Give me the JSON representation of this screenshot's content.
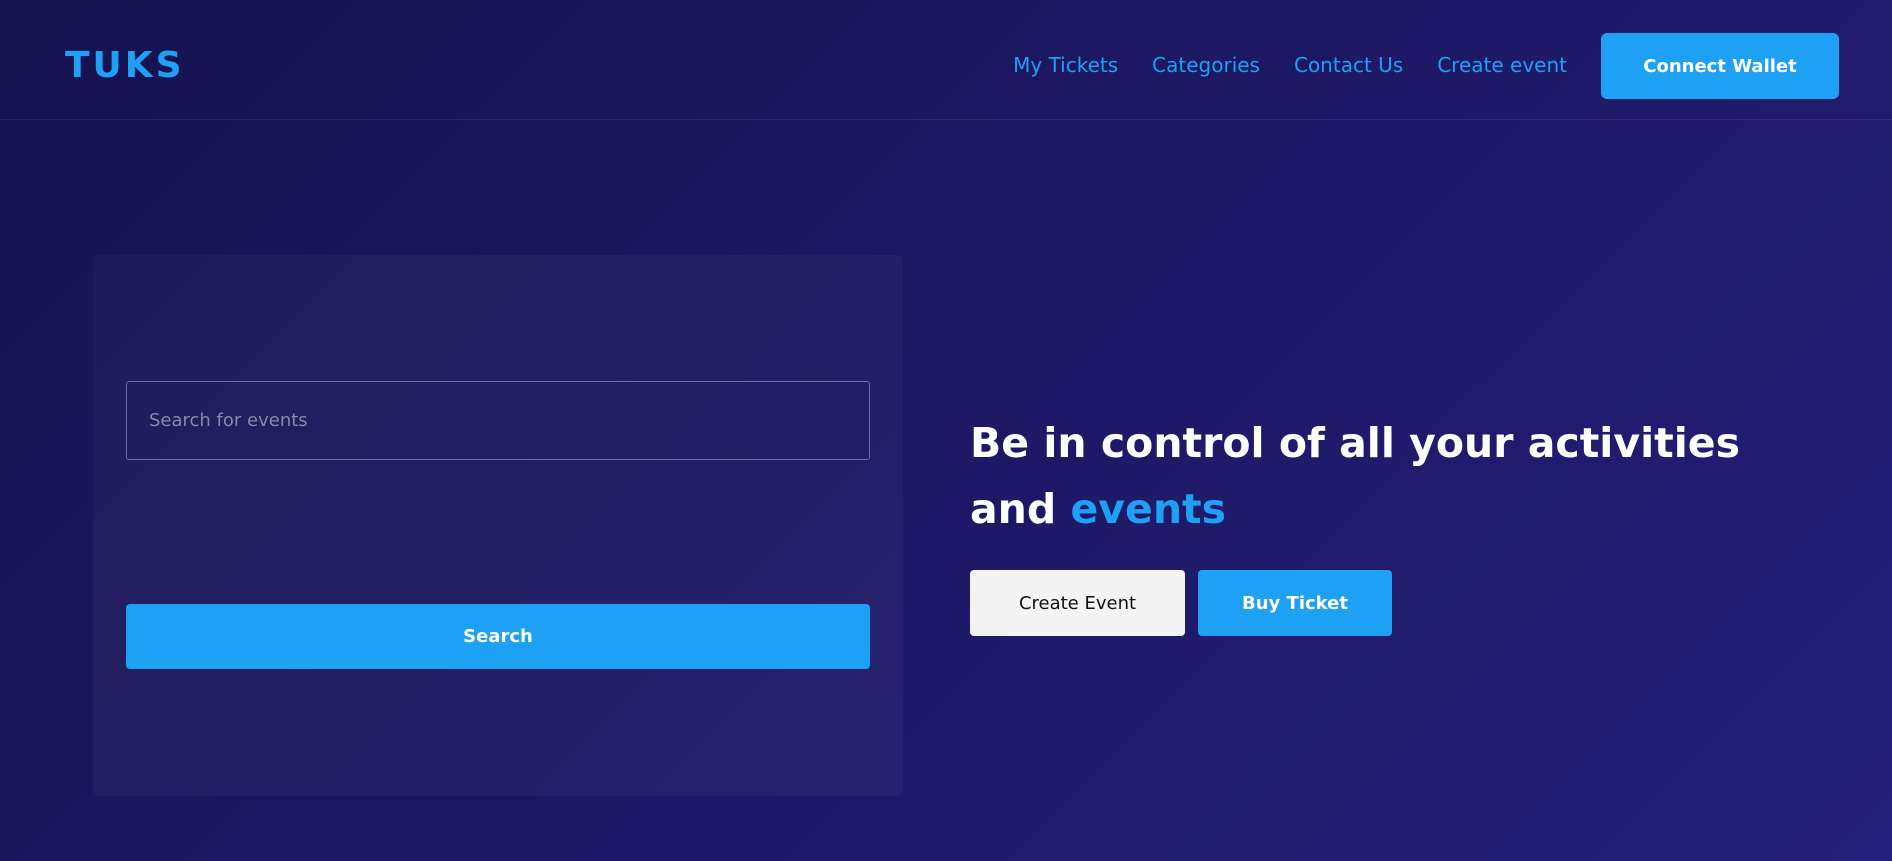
{
  "header": {
    "logo": "TUKS",
    "nav": [
      {
        "label": "My Tickets"
      },
      {
        "label": "Categories"
      },
      {
        "label": "Contact Us"
      },
      {
        "label": "Create event"
      }
    ],
    "connect_wallet_label": "Connect Wallet"
  },
  "search_panel": {
    "input_value": "",
    "input_placeholder": "Search for events",
    "search_button_label": "Search"
  },
  "hero": {
    "headline_part1": "Be in control of all your activities",
    "headline_part2": "and ",
    "headline_accent": "events",
    "create_event_label": "Create Event",
    "buy_ticket_label": "Buy Ticket"
  },
  "colors": {
    "accent": "#1ea0f5",
    "background": "#1c1760",
    "light_button": "#f4f4f4"
  }
}
